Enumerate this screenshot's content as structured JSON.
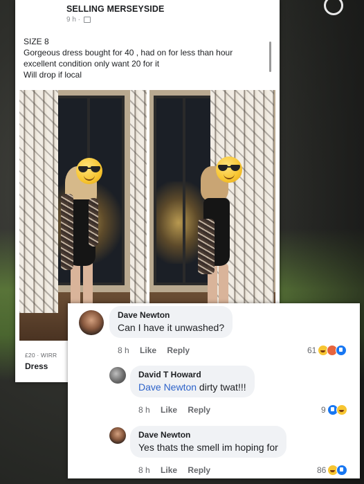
{
  "post": {
    "group_name": "SELLING MERSEYSIDE",
    "meta": "9 h ·",
    "text_lines": [
      "SIZE 8",
      "Gorgeous dress bought for 40 , had on for less than hour",
      "excellent condition only want 20 for it",
      "Will drop if local"
    ],
    "listing_price": "£20 · WIRR",
    "listing_title": "Dress"
  },
  "comments": [
    {
      "author": "Dave Newton",
      "mention": "",
      "text": "Can I have it unwashed?",
      "time": "8 h",
      "like": "Like",
      "reply": "Reply",
      "reactions_count": "61",
      "reactions": [
        "haha-icon",
        "angry-icon",
        "like-icon"
      ]
    },
    {
      "author": "David T Howard",
      "mention": "Dave Newton",
      "text": " dirty twat!!!",
      "time": "8 h",
      "like": "Like",
      "reply": "Reply",
      "reactions_count": "9",
      "reactions": [
        "like-icon",
        "haha-icon"
      ]
    },
    {
      "author": "Dave Newton",
      "mention": "",
      "text": "Yes thats the smell im hoping for",
      "time": "8 h",
      "like": "Like",
      "reply": "Reply",
      "reactions_count": "86",
      "reactions": [
        "haha-icon",
        "like-icon"
      ]
    }
  ],
  "colors": {
    "mention": "#2c62c9",
    "bubble": "#f0f2f5",
    "meta_text": "#65676b"
  }
}
